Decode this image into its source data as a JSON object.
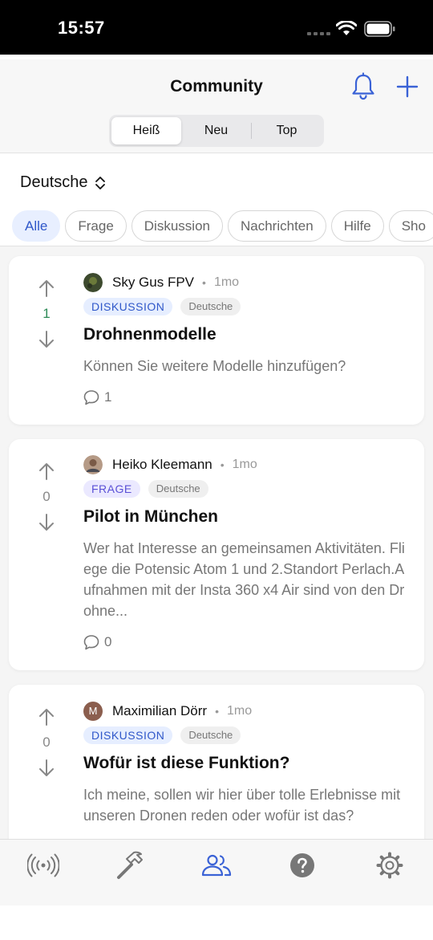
{
  "status_bar": {
    "time": "15:57"
  },
  "header": {
    "title": "Community",
    "segments": [
      "Heiß",
      "Neu",
      "Top"
    ],
    "active_segment": "Heiß",
    "accent_color": "#3a62d6"
  },
  "language_selector": {
    "label": "Deutsche"
  },
  "filters": [
    "Alle",
    "Frage",
    "Diskussion",
    "Nachrichten",
    "Hilfe",
    "Sho"
  ],
  "posts": [
    {
      "author": "Sky Gus FPV",
      "age": "1mo",
      "category": "DISKUSSION",
      "language": "Deutsche",
      "title": "Drohnenmodelle",
      "body": "Können Sie weitere Modelle hinzufügen?",
      "votes": "1",
      "comments": "1"
    },
    {
      "author": "Heiko Kleemann",
      "age": "1mo",
      "category": "FRAGE",
      "language": "Deutsche",
      "title": "Pilot in München",
      "body": "Wer hat Interesse an gemeinsamen Aktivitäten. Fliege die Potensic Atom 1 und 2.Standort Perlach.Aufnahmen mit der Insta 360 x4 Air sind von den Drohne...",
      "votes": "0",
      "comments": "0"
    },
    {
      "author": "Maximilian Dörr",
      "avatar_letter": "M",
      "age": "1mo",
      "category": "DISKUSSION",
      "language": "Deutsche",
      "title": "Wofür ist diese Funktion?",
      "body": "Ich meine, sollen wir hier über tolle Erlebnisse mit unseren Dronen reden oder wofür ist das?",
      "votes": "0"
    }
  ],
  "tab_bar": {
    "icons": [
      "broadcast-icon",
      "hammer-icon",
      "community-icon",
      "help-icon",
      "settings-icon"
    ],
    "active": "community-icon"
  }
}
